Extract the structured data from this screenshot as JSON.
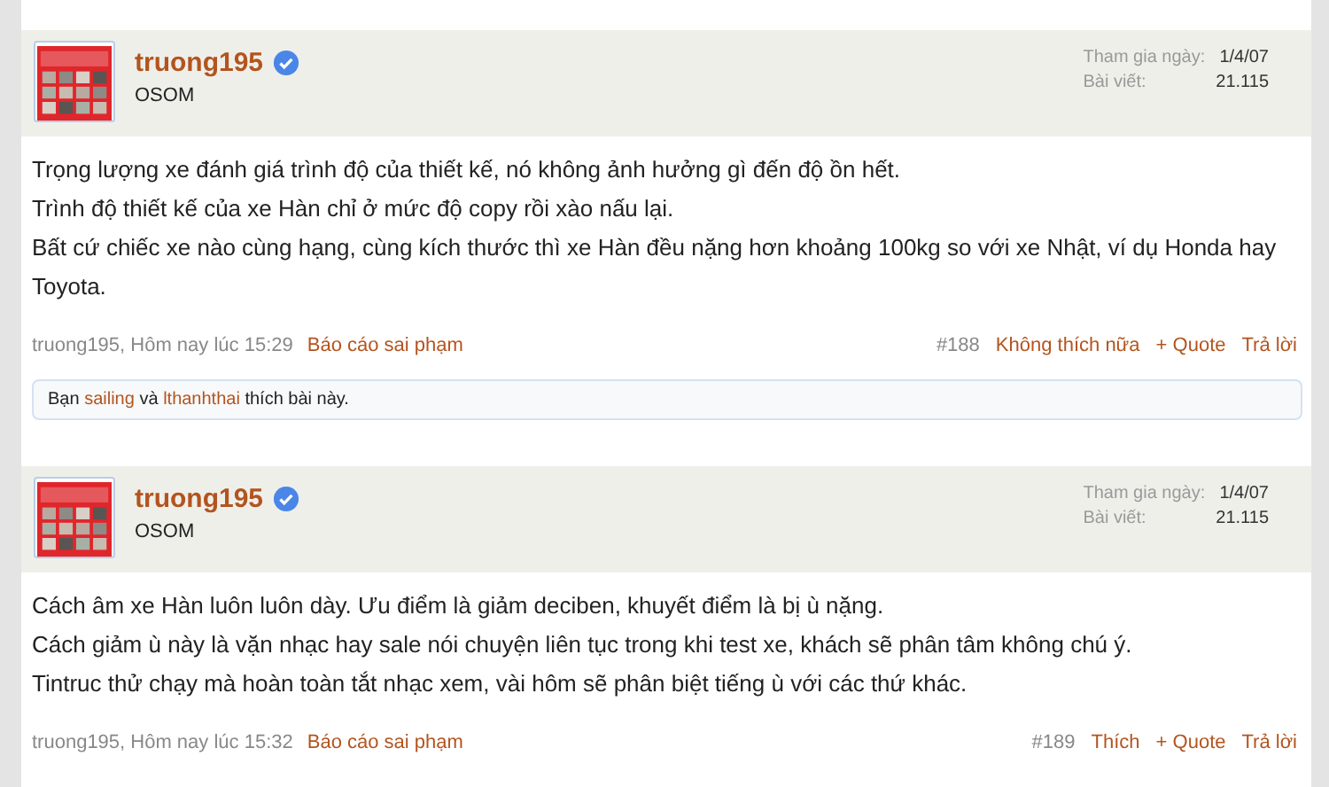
{
  "posts": [
    {
      "author": "truong195",
      "verified": true,
      "title": "OSOM",
      "stats": [
        {
          "label": "Tham gia ngày:",
          "value": "1/4/07"
        },
        {
          "label": "Bài viết:",
          "value": "21.115"
        }
      ],
      "lines": [
        "Trọng lượng xe đánh giá trình độ của thiết kế, nó không ảnh hưởng gì đến độ ồn hết.",
        "Trình độ thiết kế của xe Hàn chỉ ở mức độ copy rồi xào nấu lại.",
        "Bất cứ chiếc xe nào cùng hạng, cùng kích thước thì xe Hàn đều nặng hơn khoảng 100kg so với xe Nhật, ví dụ Honda hay Toyota."
      ],
      "byline": "truong195, Hôm nay lúc 15:29",
      "report": "Báo cáo sai phạm",
      "number": "#188",
      "like": "Không thích nữa",
      "quote": "+ Quote",
      "reply": "Trả lời",
      "likes": {
        "prefix": "Bạn",
        "users": [
          "sailing",
          "lthanhthai"
        ],
        "joiner": "và",
        "suffix": "thích bài này."
      }
    },
    {
      "author": "truong195",
      "verified": true,
      "title": "OSOM",
      "stats": [
        {
          "label": "Tham gia ngày:",
          "value": "1/4/07"
        },
        {
          "label": "Bài viết:",
          "value": "21.115"
        }
      ],
      "lines": [
        "Cách âm xe Hàn luôn luôn dày. Ưu điểm là giảm deciben, khuyết điểm là bị ù nặng.",
        "Cách giảm ù này là vặn nhạc hay sale nói chuyện liên tục trong khi test xe, khách sẽ phân tâm không chú ý.",
        "Tintruc thử chạy mà hoàn toàn tắt nhạc xem, vài hôm sẽ phân biệt tiếng ù với các thứ khác."
      ],
      "byline": "truong195, Hôm nay lúc 15:32",
      "report": "Báo cáo sai phạm",
      "number": "#189",
      "like": "Thích",
      "quote": "+ Quote",
      "reply": "Trả lời"
    }
  ]
}
